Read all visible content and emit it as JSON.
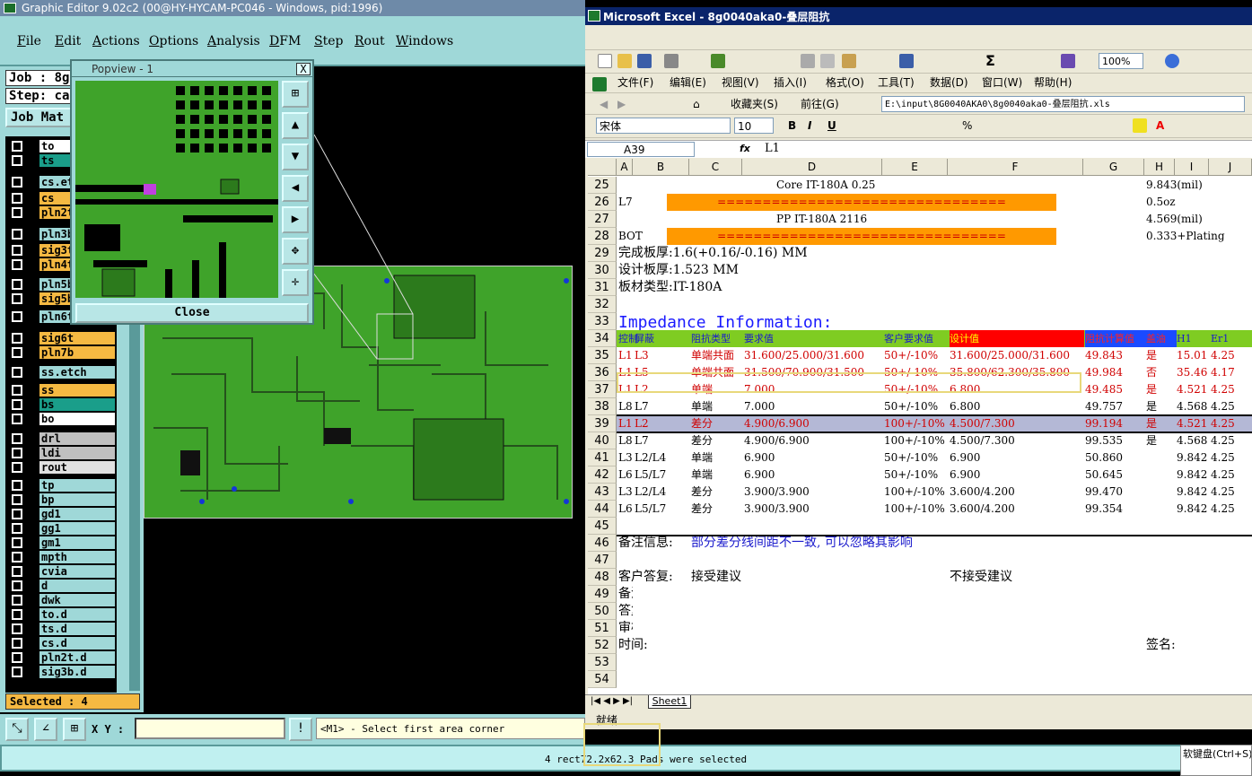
{
  "editor": {
    "title": "Graphic Editor 9.02c2 (00@HY-HYCAM-PC046 - Windows, pid:1996)",
    "menu": [
      "File",
      "Edit",
      "Actions",
      "Options",
      "Analysis",
      "DFM",
      "Step",
      "Rout",
      "Windows"
    ],
    "job_label": "Job : 8g",
    "step_label": "Step: ca",
    "job_matrix": "Job Mat",
    "layers": [
      {
        "name": "to",
        "color": "#ffffff"
      },
      {
        "name": "ts",
        "color": "#1a9e8a"
      },
      {
        "name": "cs.et",
        "color": "#9fd8d8"
      },
      {
        "name": "cs",
        "color": "#f5b942"
      },
      {
        "name": "pln2t",
        "color": "#f5b942"
      },
      {
        "name": "pln3b",
        "color": "#9fd8d8"
      },
      {
        "name": "sig3t",
        "color": "#f5b942"
      },
      {
        "name": "pln4t",
        "color": "#f5b942"
      },
      {
        "name": "pln5b",
        "color": "#9fd8d8"
      },
      {
        "name": "sig5b",
        "color": "#f5b942"
      },
      {
        "name": "pln6t",
        "color": "#9fd8d8"
      },
      {
        "name": "sig6t",
        "color": "#f5b942"
      },
      {
        "name": "pln7b",
        "color": "#f5b942"
      },
      {
        "name": "ss.etch",
        "color": "#9fd8d8"
      },
      {
        "name": "ss",
        "color": "#f5b942"
      },
      {
        "name": "bs",
        "color": "#1a9e8a"
      },
      {
        "name": "bo",
        "color": "#ffffff"
      },
      {
        "name": "drl",
        "color": "#c0c0c0"
      },
      {
        "name": "ldi",
        "color": "#c0c0c0"
      },
      {
        "name": "rout",
        "color": "#e0e0e0"
      },
      {
        "name": "tp",
        "color": "#9fd8d8"
      },
      {
        "name": "bp",
        "color": "#9fd8d8"
      },
      {
        "name": "gd1",
        "color": "#9fd8d8"
      },
      {
        "name": "gg1",
        "color": "#9fd8d8"
      },
      {
        "name": "gm1",
        "color": "#9fd8d8"
      },
      {
        "name": "mpth",
        "color": "#9fd8d8"
      },
      {
        "name": "cvia",
        "color": "#9fd8d8"
      },
      {
        "name": "d",
        "color": "#9fd8d8"
      },
      {
        "name": "dwk",
        "color": "#9fd8d8"
      },
      {
        "name": "to.d",
        "color": "#9fd8d8"
      },
      {
        "name": "ts.d",
        "color": "#9fd8d8"
      },
      {
        "name": "cs.d",
        "color": "#9fd8d8"
      },
      {
        "name": "pln2t.d",
        "color": "#9fd8d8"
      },
      {
        "name": "sig3b.d",
        "color": "#9fd8d8"
      }
    ],
    "selected": "Selected : 4",
    "xy_label": "X Y :",
    "prompt": "<M1> - Select first area corner",
    "status": "4 rect72.2x62.3 Pads were selected",
    "popview": {
      "title": "Popview - 1",
      "close": "Close",
      "close_x": "X"
    }
  },
  "excel": {
    "title": "Microsoft Excel - 8g0040aka0-叠层阻抗",
    "menu": [
      "文件(F)",
      "编辑(E)",
      "视图(V)",
      "插入(I)",
      "格式(O)",
      "工具(T)",
      "数据(D)",
      "窗口(W)",
      "帮助(H)"
    ],
    "favorites": "收藏夹(S)",
    "goto": "前往(G)",
    "path": "E:\\input\\8G0040AKA0\\8g0040aka0-叠层阻抗.xls",
    "font": "宋体",
    "size": "10",
    "zoom": "100%",
    "namebox": "A39",
    "fx": "fx",
    "formula": "L1",
    "columns": [
      "A",
      "B",
      "C",
      "D",
      "E",
      "F",
      "G",
      "H",
      "I",
      "J"
    ],
    "rows": [
      {
        "n": "25",
        "cells": [
          {
            "col": "D",
            "t": "Core      IT-180A     0.25"
          },
          {
            "col": "H",
            "t": "9.843(mil)"
          }
        ]
      },
      {
        "n": "26",
        "cells": [
          {
            "col": "A",
            "t": "L7"
          },
          {
            "col": "bar",
            "t": "================================"
          },
          {
            "col": "H",
            "t": "0.5oz"
          }
        ]
      },
      {
        "n": "27",
        "cells": [
          {
            "col": "D",
            "t": "PP      IT-180A     2116"
          },
          {
            "col": "H",
            "t": "4.569(mil)"
          }
        ]
      },
      {
        "n": "28",
        "cells": [
          {
            "col": "A",
            "t": "BOT"
          },
          {
            "col": "bar",
            "t": "================================"
          },
          {
            "col": "H",
            "t": "0.333+Plating"
          }
        ]
      },
      {
        "n": "29",
        "cells": [
          {
            "col": "A",
            "t": "完成板厚:1.6(+0.16/-0.16) MM"
          }
        ]
      },
      {
        "n": "30",
        "cells": [
          {
            "col": "A",
            "t": "设计板厚:1.523 MM"
          }
        ]
      },
      {
        "n": "31",
        "cells": [
          {
            "col": "A",
            "t": "板材类型:IT-180A"
          }
        ]
      },
      {
        "n": "32",
        "cells": []
      },
      {
        "n": "33",
        "cells": [
          {
            "col": "A",
            "t": "Impedance  Information:"
          }
        ]
      },
      {
        "n": "34",
        "cells": [
          {
            "col": "A",
            "t": "控制"
          },
          {
            "col": "B",
            "t": "屏蔽"
          },
          {
            "col": "C",
            "t": "阻抗类型"
          },
          {
            "col": "D",
            "t": "要求值"
          },
          {
            "col": "E",
            "t": "客户要求值"
          },
          {
            "col": "F",
            "t": "设计值"
          },
          {
            "col": "G",
            "t": "阻抗计算值"
          },
          {
            "col": "H",
            "t": "盖油"
          },
          {
            "col": "I",
            "t": "H1"
          },
          {
            "col": "J",
            "t": "Er1"
          }
        ]
      },
      {
        "n": "35",
        "cells": [
          {
            "col": "A",
            "t": "L1"
          },
          {
            "col": "B",
            "t": "L3"
          },
          {
            "col": "C",
            "t": "单端共面"
          },
          {
            "col": "D",
            "t": "31.600/25.000/31.600"
          },
          {
            "col": "E",
            "t": "50+/-10%"
          },
          {
            "col": "F",
            "t": "31.600/25.000/31.600"
          },
          {
            "col": "G",
            "t": "49.843"
          },
          {
            "col": "H",
            "t": "是"
          },
          {
            "col": "I",
            "t": "15.01"
          },
          {
            "col": "J",
            "t": "4.25"
          }
        ]
      },
      {
        "n": "36",
        "cells": [
          {
            "col": "A",
            "t": "L1"
          },
          {
            "col": "B",
            "t": "L5"
          },
          {
            "col": "C",
            "t": "单端共面"
          },
          {
            "col": "D",
            "t": "31.500/70.900/31.500"
          },
          {
            "col": "E",
            "t": "50+/-10%"
          },
          {
            "col": "F",
            "t": "35.800/62.300/35.800"
          },
          {
            "col": "G",
            "t": "49.984"
          },
          {
            "col": "H",
            "t": "否"
          },
          {
            "col": "I",
            "t": "35.46"
          },
          {
            "col": "J",
            "t": "4.17"
          }
        ]
      },
      {
        "n": "37",
        "cells": [
          {
            "col": "A",
            "t": "L1"
          },
          {
            "col": "B",
            "t": "L2"
          },
          {
            "col": "C",
            "t": "单端"
          },
          {
            "col": "D",
            "t": "7.000"
          },
          {
            "col": "E",
            "t": "50+/-10%"
          },
          {
            "col": "F",
            "t": "6.800"
          },
          {
            "col": "G",
            "t": "49.485"
          },
          {
            "col": "H",
            "t": "是"
          },
          {
            "col": "I",
            "t": "4.521"
          },
          {
            "col": "J",
            "t": "4.25"
          }
        ]
      },
      {
        "n": "38",
        "cells": [
          {
            "col": "A",
            "t": "L8"
          },
          {
            "col": "B",
            "t": "L7"
          },
          {
            "col": "C",
            "t": "单端"
          },
          {
            "col": "D",
            "t": "7.000"
          },
          {
            "col": "E",
            "t": "50+/-10%"
          },
          {
            "col": "F",
            "t": "6.800"
          },
          {
            "col": "G",
            "t": "49.757"
          },
          {
            "col": "H",
            "t": "是"
          },
          {
            "col": "I",
            "t": "4.568"
          },
          {
            "col": "J",
            "t": "4.25"
          }
        ]
      },
      {
        "n": "39",
        "cells": [
          {
            "col": "A",
            "t": "L1"
          },
          {
            "col": "B",
            "t": "L2"
          },
          {
            "col": "C",
            "t": "差分"
          },
          {
            "col": "D",
            "t": "4.900/6.900"
          },
          {
            "col": "E",
            "t": "100+/-10%"
          },
          {
            "col": "F",
            "t": "4.500/7.300"
          },
          {
            "col": "G",
            "t": "99.194"
          },
          {
            "col": "H",
            "t": "是"
          },
          {
            "col": "I",
            "t": "4.521"
          },
          {
            "col": "J",
            "t": "4.25"
          }
        ]
      },
      {
        "n": "40",
        "cells": [
          {
            "col": "A",
            "t": "L8"
          },
          {
            "col": "B",
            "t": "L7"
          },
          {
            "col": "C",
            "t": "差分"
          },
          {
            "col": "D",
            "t": "4.900/6.900"
          },
          {
            "col": "E",
            "t": "100+/-10%"
          },
          {
            "col": "F",
            "t": "4.500/7.300"
          },
          {
            "col": "G",
            "t": "99.535"
          },
          {
            "col": "H",
            "t": "是"
          },
          {
            "col": "I",
            "t": "4.568"
          },
          {
            "col": "J",
            "t": "4.25"
          }
        ]
      },
      {
        "n": "41",
        "cells": [
          {
            "col": "A",
            "t": "L3"
          },
          {
            "col": "B",
            "t": "L2/L4"
          },
          {
            "col": "C",
            "t": "单端"
          },
          {
            "col": "D",
            "t": "6.900"
          },
          {
            "col": "E",
            "t": "50+/-10%"
          },
          {
            "col": "F",
            "t": "6.900"
          },
          {
            "col": "G",
            "t": "50.860"
          },
          {
            "col": "I",
            "t": "9.842"
          },
          {
            "col": "J",
            "t": "4.25"
          }
        ]
      },
      {
        "n": "42",
        "cells": [
          {
            "col": "A",
            "t": "L6"
          },
          {
            "col": "B",
            "t": "L5/L7"
          },
          {
            "col": "C",
            "t": "单端"
          },
          {
            "col": "D",
            "t": "6.900"
          },
          {
            "col": "E",
            "t": "50+/-10%"
          },
          {
            "col": "F",
            "t": "6.900"
          },
          {
            "col": "G",
            "t": "50.645"
          },
          {
            "col": "I",
            "t": "9.842"
          },
          {
            "col": "J",
            "t": "4.25"
          }
        ]
      },
      {
        "n": "43",
        "cells": [
          {
            "col": "A",
            "t": "L3"
          },
          {
            "col": "B",
            "t": "L2/L4"
          },
          {
            "col": "C",
            "t": "差分"
          },
          {
            "col": "D",
            "t": "3.900/3.900"
          },
          {
            "col": "E",
            "t": "100+/-10%"
          },
          {
            "col": "F",
            "t": "3.600/4.200"
          },
          {
            "col": "G",
            "t": "99.470"
          },
          {
            "col": "I",
            "t": "9.842"
          },
          {
            "col": "J",
            "t": "4.25"
          }
        ]
      },
      {
        "n": "44",
        "cells": [
          {
            "col": "A",
            "t": "L6"
          },
          {
            "col": "B",
            "t": "L5/L7"
          },
          {
            "col": "C",
            "t": "差分"
          },
          {
            "col": "D",
            "t": "3.900/3.900"
          },
          {
            "col": "E",
            "t": "100+/-10%"
          },
          {
            "col": "F",
            "t": "3.600/4.200"
          },
          {
            "col": "G",
            "t": "99.354"
          },
          {
            "col": "I",
            "t": "9.842"
          },
          {
            "col": "J",
            "t": "4.25"
          }
        ]
      },
      {
        "n": "45",
        "cells": []
      },
      {
        "n": "46",
        "cells": [
          {
            "col": "A",
            "t": "备注信息:"
          },
          {
            "col": "C",
            "t": "部分差分线间距不一致, 可以忽略其影响"
          }
        ]
      },
      {
        "n": "47",
        "cells": []
      },
      {
        "n": "48",
        "cells": [
          {
            "col": "A",
            "t": "客户答复:"
          },
          {
            "col": "C",
            "t": "接受建议"
          },
          {
            "col": "F",
            "t": "不接受建议"
          }
        ]
      },
      {
        "n": "49",
        "cells": [
          {
            "col": "A",
            "t": "备注:"
          }
        ]
      },
      {
        "n": "50",
        "cells": [
          {
            "col": "A",
            "t": "答复:"
          }
        ]
      },
      {
        "n": "51",
        "cells": [
          {
            "col": "A",
            "t": "审核:"
          }
        ]
      },
      {
        "n": "52",
        "cells": [
          {
            "col": "A",
            "t": "时间:"
          },
          {
            "col": "H",
            "t": "签名:"
          }
        ]
      },
      {
        "n": "53",
        "cells": []
      },
      {
        "n": "54",
        "cells": []
      }
    ],
    "sheet_tab": "Sheet1",
    "status": "就绪",
    "ime": "软键盘(Ctrl+S)"
  }
}
